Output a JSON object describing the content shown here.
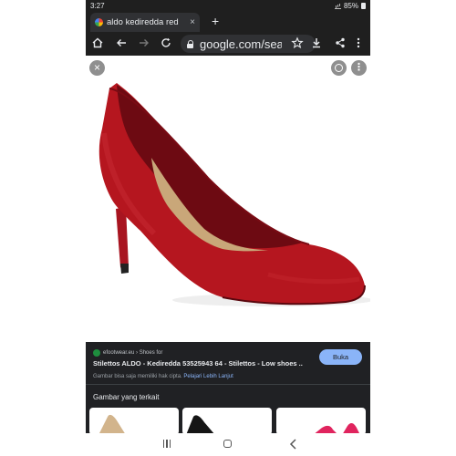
{
  "status_bar": {
    "time": "3:27",
    "battery": "85%"
  },
  "browser": {
    "tab_title": "aldo kediredda red",
    "tab_close": "×",
    "new_tab": "+",
    "url": "google.com/search",
    "icons": [
      "home-icon",
      "back-icon",
      "forward-icon",
      "reload-icon",
      "lock-icon",
      "star-icon",
      "download-icon",
      "share-icon",
      "menu-icon"
    ]
  },
  "viewer": {
    "close": "×",
    "more": "⋮",
    "image_subject": "red suede pointed-toe stiletto pump"
  },
  "result": {
    "source": "efootwear.eu › Shoes for",
    "title": "Stilettos ALDO - Kediredda 53525943 64 - Stilettos - Low shoes ...",
    "copyright_text": "Gambar bisa saja memiliki hak cipta.",
    "learn_more": "Pelajari Lebih Lanjut",
    "visit_button": "Buka"
  },
  "related": {
    "heading": "Gambar yang terkait"
  },
  "colors": {
    "shoe_red": "#b5161f",
    "panel_bg": "#202124",
    "button_blue": "#8ab4f8"
  }
}
